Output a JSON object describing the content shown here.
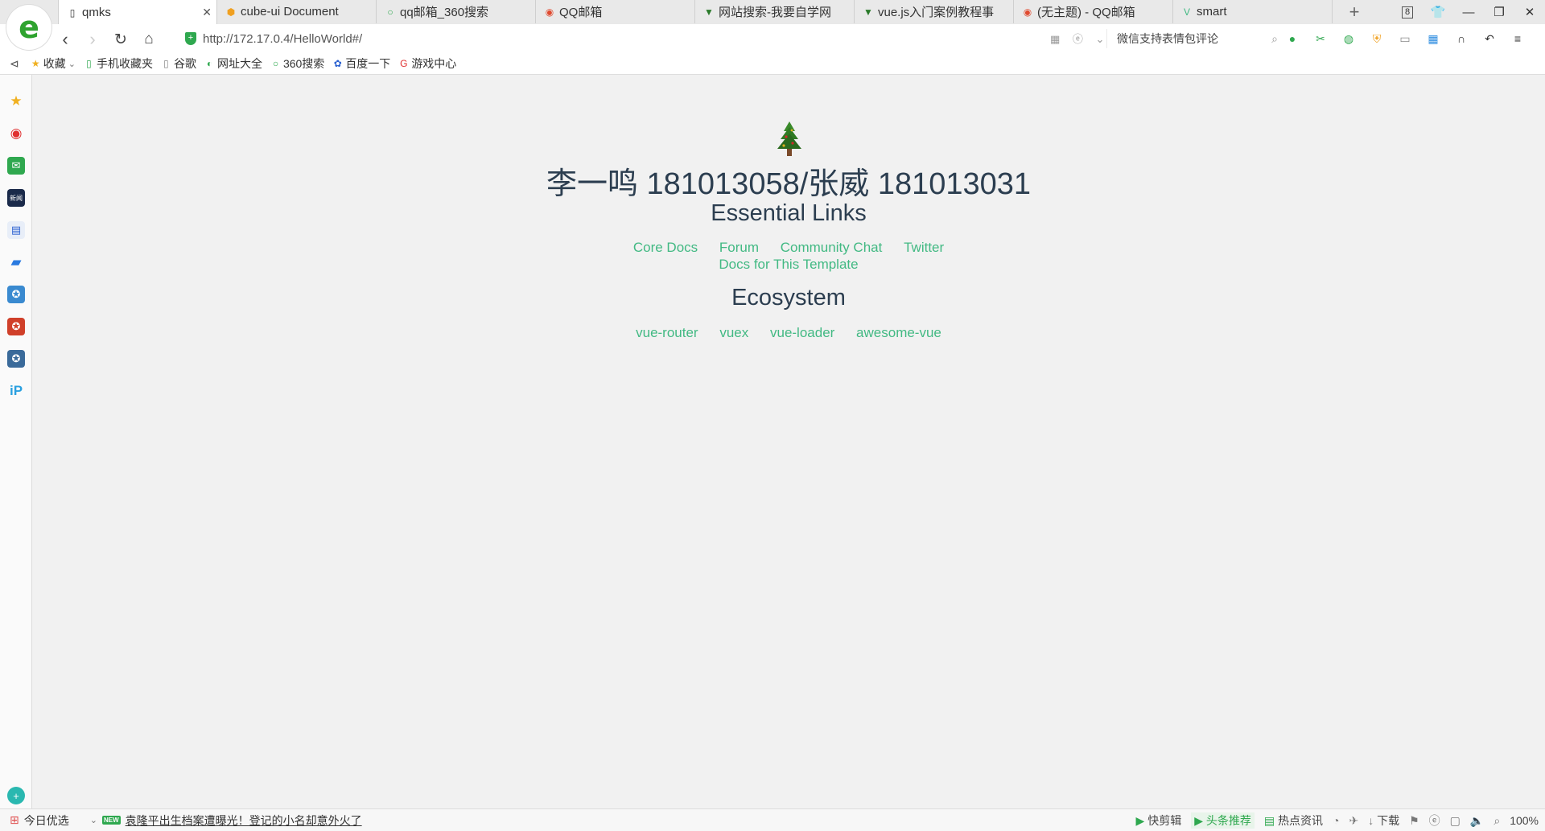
{
  "browser": {
    "tabs": [
      {
        "label": "qmks",
        "icon": "page-icon",
        "active": true
      },
      {
        "label": "cube-ui Document",
        "icon": "site-icon"
      },
      {
        "label": "qq邮箱_360搜索",
        "icon": "360search-icon"
      },
      {
        "label": "QQ邮箱",
        "icon": "browser-icon"
      },
      {
        "label": "网站搜索-我要自学网",
        "icon": "site-icon"
      },
      {
        "label": "vue.js入门案例教程事",
        "icon": "site-icon"
      },
      {
        "label": "(无主题) - QQ邮箱",
        "icon": "browser-icon"
      },
      {
        "label": "smart",
        "icon": "vue-icon"
      }
    ],
    "tab_count": "8",
    "address": "http://172.17.0.4/HelloWorld#/",
    "address_host": "172.17.0.4",
    "search_placeholder": "微信支持表情包评论",
    "bookmarks": [
      {
        "label": "收藏",
        "icon": "star-icon"
      },
      {
        "label": "手机收藏夹",
        "icon": "phone-icon"
      },
      {
        "label": "谷歌",
        "icon": "page-icon"
      },
      {
        "label": "网址大全",
        "icon": "nav-icon"
      },
      {
        "label": "360搜索",
        "icon": "360search-icon"
      },
      {
        "label": "百度一下",
        "icon": "baidu-icon"
      },
      {
        "label": "游戏中心",
        "icon": "game-icon"
      }
    ],
    "status": {
      "today": "今日优选",
      "news_badge": "NEW",
      "headline": "袁隆平出生档案遭曝光！登记的小名却意外火了",
      "right_items": [
        "快剪辑",
        "头条推荐",
        "热点资讯",
        "下载"
      ],
      "zoom": "100%"
    }
  },
  "page": {
    "title": "李一鸣 181013058/张威 181013031",
    "essential_heading": "Essential Links",
    "essential_links": [
      "Core Docs",
      "Forum",
      "Community Chat",
      "Twitter"
    ],
    "essential_links_2": "Docs for This Template",
    "ecosystem_heading": "Ecosystem",
    "ecosystem_links": [
      "vue-router",
      "vuex",
      "vue-loader",
      "awesome-vue"
    ]
  },
  "colors": {
    "link": "#42b983",
    "heading": "#2c3e50",
    "accent": "#2fa84f"
  }
}
